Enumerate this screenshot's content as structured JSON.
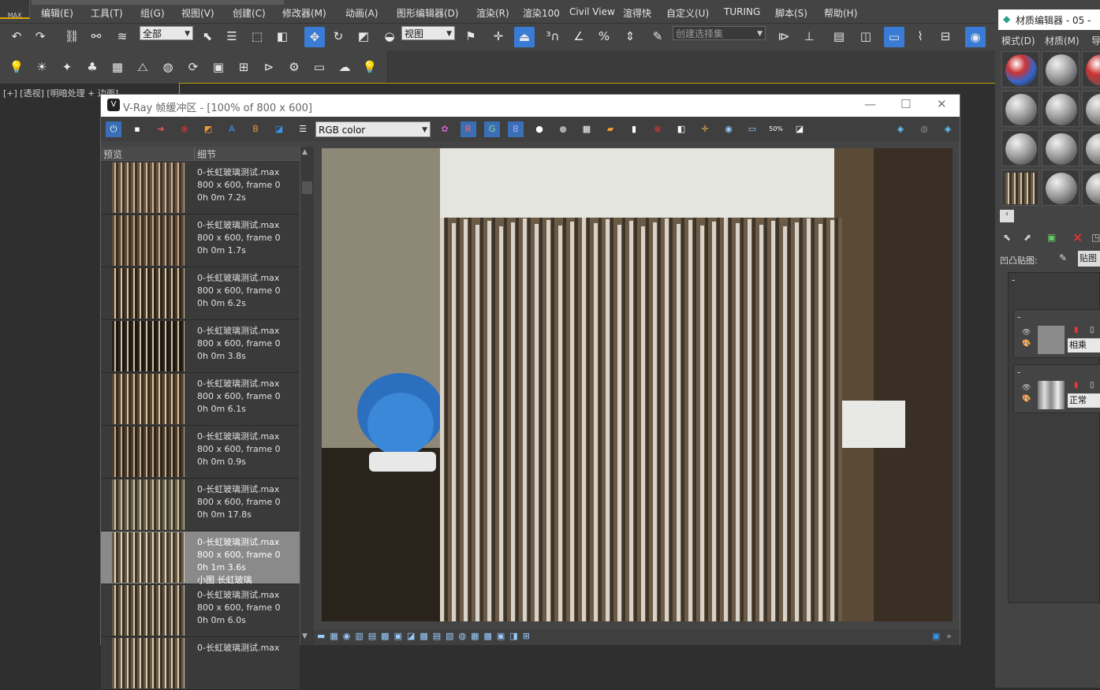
{
  "app": {
    "logo_text": "MAX"
  },
  "menu": [
    "编辑(E)",
    "工具(T)",
    "组(G)",
    "视图(V)",
    "创建(C)",
    "修改器(M)",
    "动画(A)",
    "图形编辑器(D)",
    "渲染(R)",
    "渲染100",
    "Civil View",
    "渲得快",
    "自定义(U)",
    "TURING",
    "脚本(S)",
    "帮助(H)"
  ],
  "toolbar": {
    "selection_filter": "全部",
    "ref_coord": "视图",
    "named_selection_placeholder": "创建选择集"
  },
  "viewport": {
    "label": "[+] [透视] [明暗处理 + 边面]"
  },
  "vfb": {
    "title": "V-Ray 帧缓冲区 - [100% of 800 x 600]",
    "channel": "RGB color",
    "channel_buttons": [
      "R",
      "G",
      "B"
    ],
    "history_headers": [
      "预览",
      "细节"
    ],
    "history": [
      {
        "name": "0-长虹玻璃测试.max",
        "res": "800 x 600, frame 0",
        "time": "0h 0m 7.2s",
        "note": "",
        "tone": [
          "#6b5540",
          "#c9b79a",
          "#3d3327"
        ],
        "selected": false
      },
      {
        "name": "0-长虹玻璃测试.max",
        "res": "800 x 600, frame 0",
        "time": "0h 0m 1.7s",
        "note": "",
        "tone": [
          "#5e4b37",
          "#bda98a",
          "#36291d"
        ],
        "selected": false
      },
      {
        "name": "0-长虹玻璃测试.max",
        "res": "800 x 600, frame 0",
        "time": "0h 0m 6.2s",
        "note": "",
        "tone": [
          "#4a3a2a",
          "#d8c9a8",
          "#2a2018"
        ],
        "selected": false
      },
      {
        "name": "0-长虹玻璃测试.max",
        "res": "800 x 600, frame 0",
        "time": "0h 0m 3.8s",
        "note": "",
        "tone": [
          "#2b221a",
          "#cfc3a5",
          "#1a1410"
        ],
        "selected": false
      },
      {
        "name": "0-长虹玻璃测试.max",
        "res": "800 x 600, frame 0",
        "time": "0h 0m 6.1s",
        "note": "",
        "tone": [
          "#5a4732",
          "#d6c6a4",
          "#3a2c1f"
        ],
        "selected": false
      },
      {
        "name": "0-长虹玻璃测试.max",
        "res": "800 x 600, frame 0",
        "time": "0h 0m 0.9s",
        "note": "",
        "tone": [
          "#4c3b2a",
          "#bfae8f",
          "#2c2218"
        ],
        "selected": false
      },
      {
        "name": "0-长虹玻璃测试.max",
        "res": "800 x 600, frame 0",
        "time": "0h 0m 17.8s",
        "note": "",
        "tone": [
          "#6d6248",
          "#cbc4aa",
          "#3a3328"
        ],
        "selected": false
      },
      {
        "name": "0-长虹玻璃测试.max",
        "res": "800 x 600, frame 0",
        "time": "0h 1m 3.6s",
        "note": "小图 长虹玻璃",
        "tone": [
          "#6a5a44",
          "#e0d6c0",
          "#3e3428"
        ],
        "selected": true
      },
      {
        "name": "0-长虹玻璃测试.max",
        "res": "800 x 600, frame 0",
        "time": "0h 0m 6.0s",
        "note": "",
        "tone": [
          "#5f5240",
          "#d4c8ad",
          "#362d22"
        ],
        "selected": false
      },
      {
        "name": "0-长虹玻璃测试.max",
        "res": "",
        "time": "",
        "note": "",
        "tone": [
          "#6a5a44",
          "#d8cdb4",
          "#3a3024"
        ],
        "selected": false
      }
    ]
  },
  "material_editor": {
    "title": "材质编辑器 - 05 -",
    "menu": [
      "模式(D)",
      "材质(M)",
      "导"
    ],
    "map_label": "凹凸贴图:",
    "map_btn": "贴图",
    "blend1": "相乘",
    "blend2": "正常"
  }
}
